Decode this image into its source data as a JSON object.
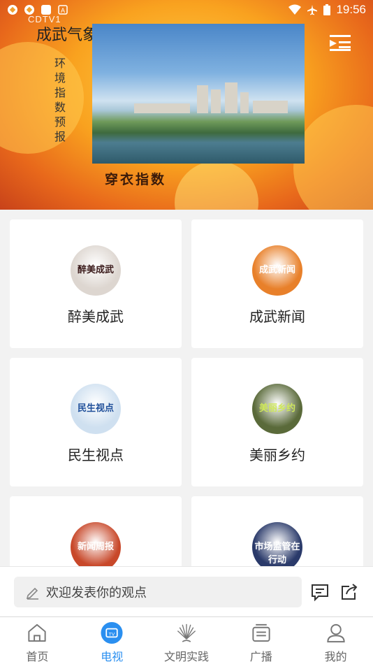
{
  "status_bar": {
    "time": "19:56"
  },
  "hero": {
    "logo_text": "CDTV1",
    "brand": "成武气象",
    "vertical_text": "环境指数预报",
    "caption": "穿衣指数"
  },
  "programs": [
    {
      "label": "醉美成武",
      "thumb_text": "醉美成武",
      "thumb_color": "#ddd6d0",
      "thumb_text_color": "#3a1a1a"
    },
    {
      "label": "成武新闻",
      "thumb_text": "成武新闻",
      "thumb_color": "#e8802a",
      "thumb_text_color": "#ffffff"
    },
    {
      "label": "民生视点",
      "thumb_text": "民生视点",
      "thumb_color": "#cfe0f0",
      "thumb_text_color": "#1f4f9a"
    },
    {
      "label": "美丽乡约",
      "thumb_text": "美丽乡约",
      "thumb_color": "#5a6a3a",
      "thumb_text_color": "#cfe85a"
    },
    {
      "label": "",
      "thumb_text": "新闻周报",
      "thumb_color": "#c8482a",
      "thumb_text_color": "#ffffff"
    },
    {
      "label": "",
      "thumb_text": "市场监管在行动",
      "thumb_color": "#2a3a6a",
      "thumb_text_color": "#ffffff"
    }
  ],
  "comment": {
    "placeholder": "欢迎发表你的观点"
  },
  "nav": [
    {
      "label": "首页",
      "icon": "home-icon"
    },
    {
      "label": "电视",
      "icon": "tv-icon"
    },
    {
      "label": "文明实践",
      "icon": "fan-icon"
    },
    {
      "label": "广播",
      "icon": "radio-icon"
    },
    {
      "label": "我的",
      "icon": "user-icon"
    }
  ],
  "colors": {
    "accent": "#2a8ff0",
    "hero_orange": "#f9a21f"
  }
}
